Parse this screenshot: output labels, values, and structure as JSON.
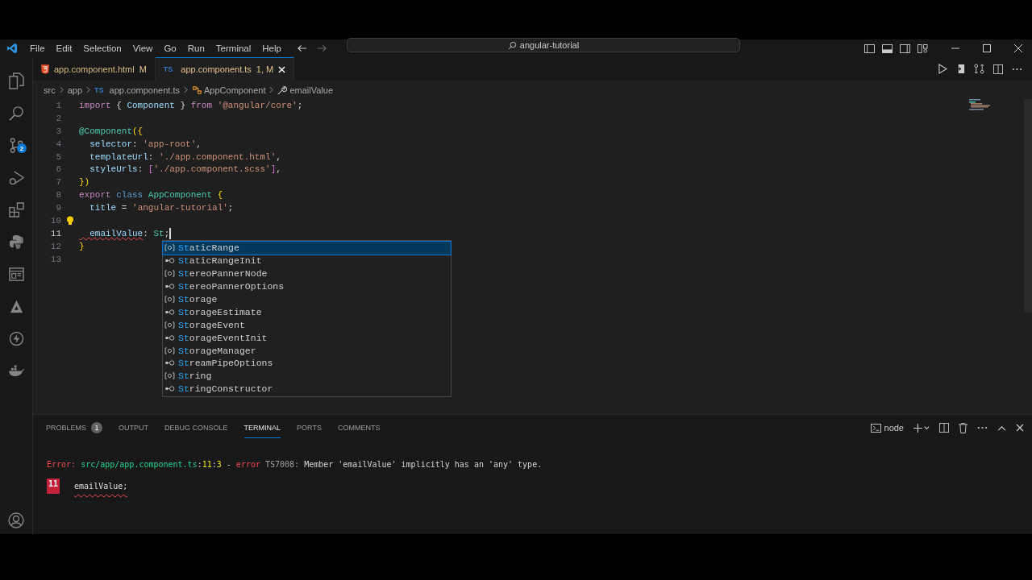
{
  "menu": [
    "File",
    "Edit",
    "Selection",
    "View",
    "Go",
    "Run",
    "Terminal",
    "Help"
  ],
  "command_center": {
    "text": "angular-tutorial"
  },
  "activity_bar": [
    {
      "kind": "files"
    },
    {
      "kind": "search"
    },
    {
      "kind": "source-control",
      "badge": "2"
    },
    {
      "kind": "run"
    },
    {
      "kind": "extensions"
    },
    {
      "kind": "python"
    },
    {
      "kind": "browser"
    },
    {
      "kind": "triangle"
    },
    {
      "kind": "bolt"
    },
    {
      "kind": "whale"
    }
  ],
  "tabs": [
    {
      "kind": "html",
      "label": "app.component.html",
      "status": "M",
      "selected": false
    },
    {
      "kind": "ts",
      "icon": "TS",
      "label": "app.component.ts",
      "status": "1, M",
      "selected": true
    }
  ],
  "breadcrumb": [
    {
      "kind": "text",
      "label": "src"
    },
    {
      "kind": "text",
      "label": "app"
    },
    {
      "kind": "ts",
      "icon": "TS",
      "label": "app.component.ts"
    },
    {
      "kind": "class",
      "label": "AppComponent"
    },
    {
      "kind": "property",
      "label": "emailValue"
    }
  ],
  "editor": {
    "lines": [
      {
        "number": "1",
        "current": false,
        "bulb": false,
        "tokens": [
          {
            "t": "import",
            "kind": "kw"
          },
          {
            "t": " { ",
            "kind": "p"
          },
          {
            "t": "Component",
            "kind": "var"
          },
          {
            "t": " } ",
            "kind": "p"
          },
          {
            "t": "from",
            "kind": "kw"
          },
          {
            "t": " '@angular/core'",
            "kind": "str"
          },
          {
            "t": ";",
            "kind": "p"
          }
        ]
      },
      {
        "number": "2",
        "current": false,
        "bulb": false
      },
      {
        "number": "3",
        "current": false,
        "bulb": false,
        "tokens": [
          {
            "t": "@Component",
            "kind": "type"
          },
          {
            "t": "({",
            "kind": "br"
          }
        ]
      },
      {
        "number": "4",
        "current": false,
        "bulb": false,
        "tokens": [
          {
            "t": "  selector",
            "kind": "var"
          },
          {
            "t": ": ",
            "kind": "p"
          },
          {
            "t": "'app-root'",
            "kind": "str"
          },
          {
            "t": ",",
            "kind": "p"
          }
        ]
      },
      {
        "number": "5",
        "current": false,
        "bulb": false,
        "tokens": [
          {
            "t": "  templateUrl",
            "kind": "var"
          },
          {
            "t": ": ",
            "kind": "p"
          },
          {
            "t": "'./app.component.html'",
            "kind": "str"
          },
          {
            "t": ",",
            "kind": "p"
          }
        ]
      },
      {
        "number": "6",
        "current": false,
        "bulb": false,
        "tokens": [
          {
            "t": "  styleUrls",
            "kind": "var"
          },
          {
            "t": ": ",
            "kind": "p"
          },
          {
            "t": "[",
            "kind": "br2"
          },
          {
            "t": "'./app.component.scss'",
            "kind": "str"
          },
          {
            "t": "]",
            "kind": "br2"
          },
          {
            "t": ",",
            "kind": "p"
          }
        ]
      },
      {
        "number": "7",
        "current": false,
        "bulb": false,
        "tokens": [
          {
            "t": "})",
            "kind": "br"
          }
        ]
      },
      {
        "number": "8",
        "current": false,
        "bulb": false,
        "tokens": [
          {
            "t": "export",
            "kind": "kw"
          },
          {
            "t": " class",
            "kind": "kw2"
          },
          {
            "t": " AppComponent",
            "kind": "type"
          },
          {
            "t": " {",
            "kind": "br"
          }
        ]
      },
      {
        "number": "9",
        "current": false,
        "bulb": false,
        "tokens": [
          {
            "t": "  title",
            "kind": "var"
          },
          {
            "t": " = ",
            "kind": "p"
          },
          {
            "t": "'angular-tutorial'",
            "kind": "str"
          },
          {
            "t": ";",
            "kind": "p"
          }
        ]
      },
      {
        "number": "10",
        "current": false,
        "bulb": true
      },
      {
        "number": "11",
        "current": true,
        "bulb": false,
        "tokens": [
          {
            "t": "  emailValue",
            "kind": "err"
          },
          {
            "t": ": ",
            "kind": "p"
          },
          {
            "t": "St",
            "kind": "type"
          },
          {
            "t": ";",
            "kind": "p"
          }
        ]
      },
      {
        "number": "12",
        "current": false,
        "bulb": false,
        "tokens": [
          {
            "t": "}",
            "kind": "br"
          }
        ]
      },
      {
        "number": "13",
        "current": false,
        "bulb": false
      }
    ]
  },
  "suggestions": {
    "items": [
      {
        "kind": "class",
        "match": "St",
        "rest": "aticRange",
        "selected": true
      },
      {
        "kind": "interface",
        "match": "St",
        "rest": "aticRangeInit",
        "selected": false
      },
      {
        "kind": "class",
        "match": "St",
        "rest": "ereoPannerNode",
        "selected": false
      },
      {
        "kind": "interface",
        "match": "St",
        "rest": "ereoPannerOptions",
        "selected": false
      },
      {
        "kind": "class",
        "match": "St",
        "rest": "orage",
        "selected": false
      },
      {
        "kind": "interface",
        "match": "St",
        "rest": "orageEstimate",
        "selected": false
      },
      {
        "kind": "class",
        "match": "St",
        "rest": "orageEvent",
        "selected": false
      },
      {
        "kind": "interface",
        "match": "St",
        "rest": "orageEventInit",
        "selected": false
      },
      {
        "kind": "class",
        "match": "St",
        "rest": "orageManager",
        "selected": false
      },
      {
        "kind": "interface",
        "match": "St",
        "rest": "reamPipeOptions",
        "selected": false
      },
      {
        "kind": "class",
        "match": "St",
        "rest": "ring",
        "selected": false
      },
      {
        "kind": "interface",
        "match": "St",
        "rest": "ringConstructor",
        "selected": false
      }
    ]
  },
  "panel": {
    "tabs": [
      {
        "label": "PROBLEMS",
        "badge": "1",
        "selected": false
      },
      {
        "label": "OUTPUT",
        "selected": false
      },
      {
        "label": "DEBUG CONSOLE",
        "selected": false
      },
      {
        "label": "TERMINAL",
        "selected": true
      },
      {
        "label": "PORTS",
        "selected": false
      },
      {
        "label": "COMMENTS",
        "selected": false
      }
    ],
    "terminal_name": "node",
    "error_line": [
      {
        "t": "Error: ",
        "kind": "errlabel"
      },
      {
        "t": "src/app/app.component.ts",
        "kind": "path"
      },
      {
        "t": ":",
        "kind": "p"
      },
      {
        "t": "11",
        "kind": "num"
      },
      {
        "t": ":",
        "kind": "p"
      },
      {
        "t": "3",
        "kind": "num"
      },
      {
        "t": " - ",
        "kind": "p"
      },
      {
        "t": "error",
        "kind": "errlabel"
      },
      {
        "t": " TS7008:",
        "kind": "dim"
      },
      {
        "t": " Member 'emailValue' implicitly has an 'any' type.",
        "kind": "p"
      }
    ],
    "source_line_number": "11",
    "source_line": "emailValue;"
  }
}
